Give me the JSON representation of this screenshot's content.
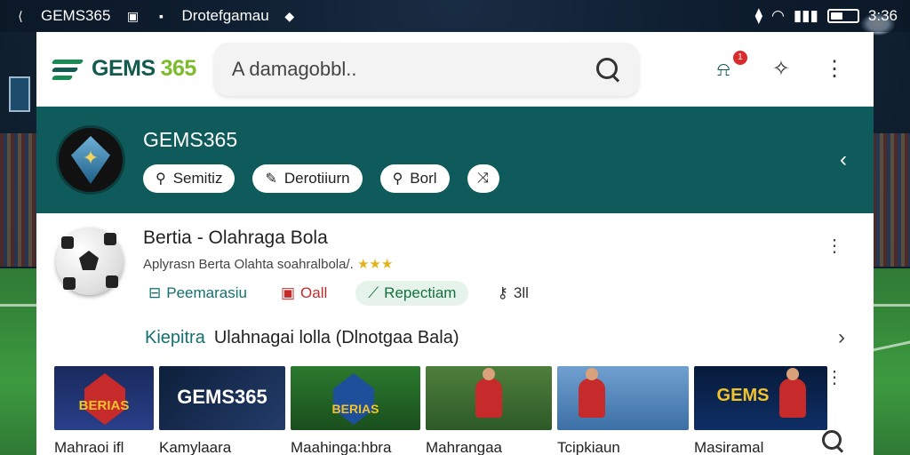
{
  "status_bar": {
    "carrier": "GEMS365",
    "notification_text": "Drotefgamau",
    "time": "3:36"
  },
  "header": {
    "logo_text": "GEMS",
    "logo_number": "365",
    "search_value": "A damagobbl..",
    "notification_count": "1"
  },
  "hero": {
    "title": "GEMS365",
    "chips": [
      {
        "icon": "search-icon",
        "label": "Semitiz"
      },
      {
        "icon": "pen-icon",
        "label": "Derotiiurn"
      },
      {
        "icon": "search-icon",
        "label": "Borl"
      },
      {
        "icon": "share-icon",
        "label": ""
      }
    ]
  },
  "app": {
    "name": "Bertia - Olahraga Bola",
    "subtitle": "Aplyrasn Berta Olahta soahralbola/.",
    "rating_stars": "★★★",
    "actions": [
      {
        "icon": "table-icon",
        "label": "Peemarasiu"
      },
      {
        "icon": "square-icon",
        "label": "Oall"
      },
      {
        "icon": "link-icon",
        "label": "Repectiam"
      },
      {
        "icon": "key-icon",
        "label": "3ll"
      }
    ],
    "link_key": "Kiepitra",
    "link_value": "Ulahnagai lolla (Dlnotgaa Bala)"
  },
  "thumbnails": [
    {
      "image_text": "BERIAS",
      "label": "Mahraoi ifl"
    },
    {
      "image_text": "GEMS365",
      "label": "Kamylaara"
    },
    {
      "image_text": "BERIAS",
      "label": "Maahinga:hbra"
    },
    {
      "image_text": "",
      "label": "Mahrangaa"
    },
    {
      "image_text": "",
      "label": "Tcipkiaun"
    },
    {
      "image_text": "GEMS",
      "label": "Masiramal"
    }
  ],
  "colors": {
    "teal": "#0f5a5a",
    "brand_green": "#7cbc2a",
    "brand_dark": "#135a4f",
    "badge_red": "#d92b2b"
  }
}
